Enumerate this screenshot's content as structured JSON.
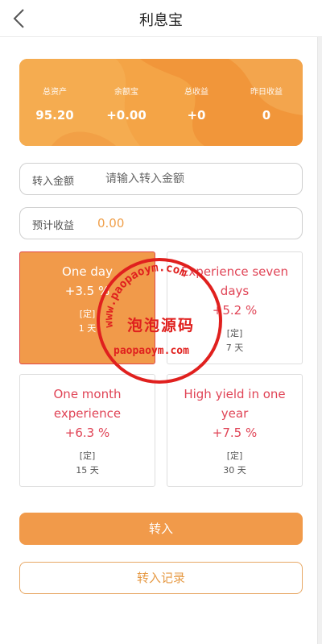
{
  "header": {
    "title": "利息宝"
  },
  "summary": {
    "stats": [
      {
        "label": "总资产",
        "value": "95.20"
      },
      {
        "label": "余额宝",
        "value": "+0.00"
      },
      {
        "label": "总收益",
        "value": "+0"
      },
      {
        "label": "昨日收益",
        "value": "0"
      }
    ]
  },
  "transfer_field": {
    "label": "转入金额",
    "placeholder": "请输入转入金额"
  },
  "estimate_field": {
    "label": "预计收益",
    "value": "0.00"
  },
  "plans": [
    {
      "name": "One day",
      "rate": "+3.5 %",
      "tag": "[定]",
      "days": "1 天",
      "active": true
    },
    {
      "name": "Experience seven days",
      "rate": "+5.2 %",
      "tag": "[定]",
      "days": "7 天",
      "active": false
    },
    {
      "name": "One month experience",
      "rate": "+6.3 %",
      "tag": "[定]",
      "days": "15 天",
      "active": false
    },
    {
      "name": "High yield in one year",
      "rate": "+7.5 %",
      "tag": "[定]",
      "days": "30 天",
      "active": false
    }
  ],
  "buttons": {
    "transfer_in": "转入",
    "records": "转入记录"
  },
  "watermark": {
    "arc_text": "www.paopaoym.com",
    "center_text": "泡泡源码",
    "bottom_text": "paopaoym.com"
  },
  "colors": {
    "accent": "#f19a4a",
    "rate_text": "#e04456",
    "stamp": "#e0201e",
    "estimate_value": "#f0a04b"
  }
}
